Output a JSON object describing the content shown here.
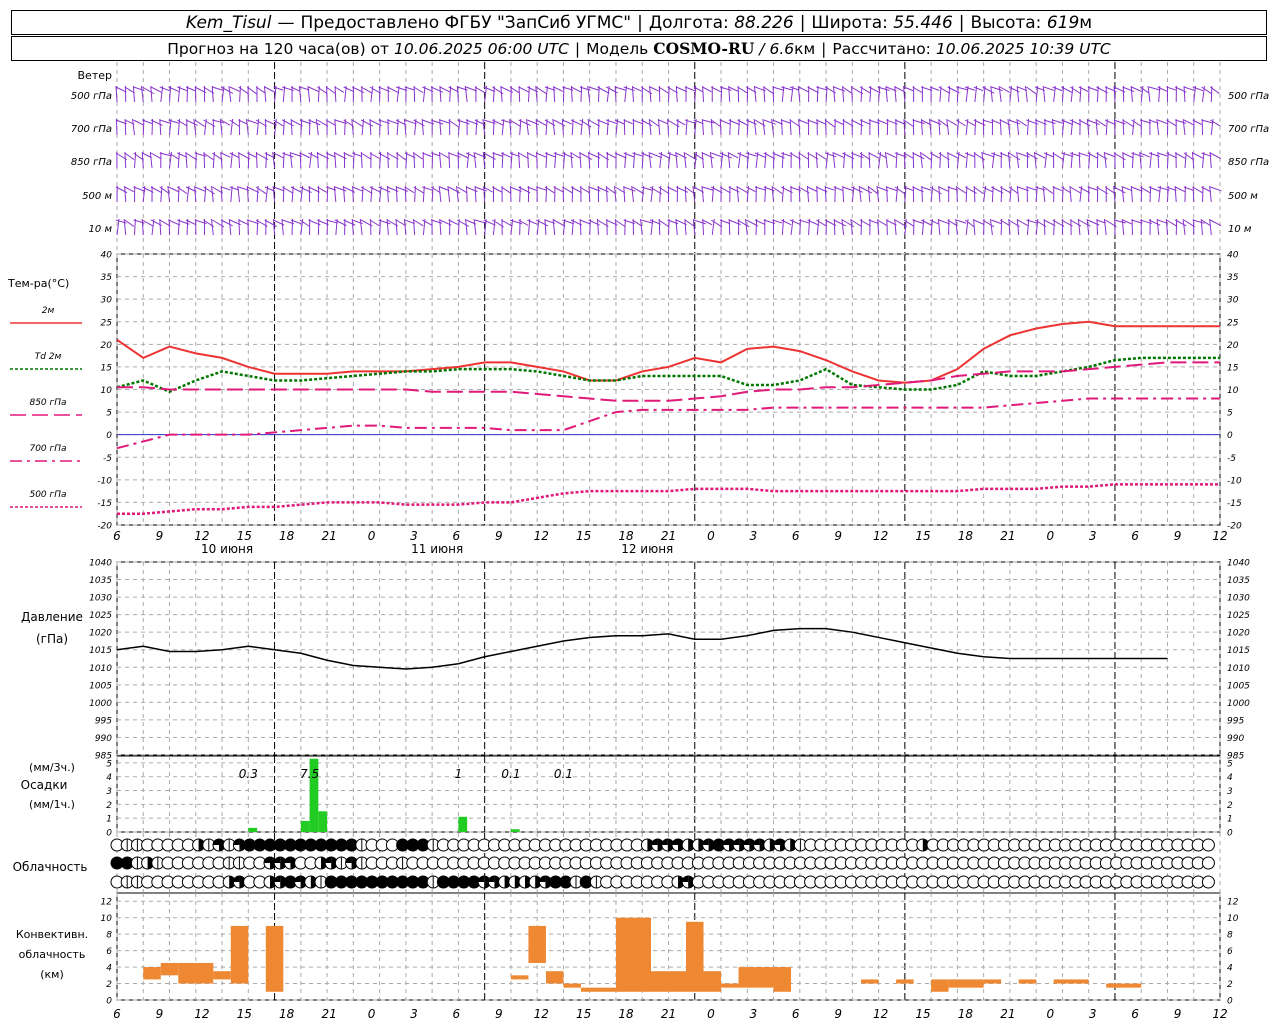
{
  "header": {
    "station": "Kem_Tisul",
    "provider": "Предоставлено ФГБУ \"ЗапСиб УГМС\"",
    "lon_label": "Долгота:",
    "lon_value": "88.226",
    "lat_label": "Широта:",
    "lat_value": "55.446",
    "alt_label": "Высота:",
    "alt_value": "619",
    "alt_unit": "м",
    "forecast_label": "Прогноз на 120 часа(ов)",
    "from_label": "от",
    "init_time": "10.06.2025 06:00 UTC",
    "model_label": "Модель",
    "model_name": "COSMO-RU",
    "model_res": "6.6",
    "model_res_unit": "км",
    "calc_label": "Рассчитано:",
    "calc_time": "10.06.2025 10:39 UTC"
  },
  "colors": {
    "t2m": "#ee3333",
    "td2m": "#007700",
    "t850": "#e0197a",
    "t700": "#e0197a",
    "t500": "#e0197a",
    "wind": "#8833cc",
    "precip": "#22cc22",
    "conv": "#ee8833",
    "pressure": "#000000",
    "zero_line": "#3333cc"
  },
  "wind_panel": {
    "title": "Ветер",
    "levels": [
      "500 гПа",
      "700 гПа",
      "850 гПа",
      "500 м",
      "10  м"
    ]
  },
  "time_axis": {
    "hour_labels": [
      "6",
      "9",
      "12",
      "15",
      "18",
      "21",
      "0",
      "3",
      "6",
      "9",
      "12",
      "15",
      "18",
      "21",
      "0",
      "3",
      "6",
      "9",
      "12",
      "15",
      "18",
      "21",
      "0",
      "3",
      "6",
      "9",
      "12"
    ],
    "dates": [
      "10 июня",
      "11 июня",
      "12 июня"
    ]
  },
  "chart_data": [
    {
      "type": "line",
      "title": "Тем-ра(°C)",
      "x_unit": "hours since 10.06.2025 06:00 UTC",
      "ylim": [
        -20,
        40
      ],
      "yticks": [
        -20,
        -15,
        -10,
        -5,
        0,
        5,
        10,
        15,
        20,
        25,
        30,
        35,
        40
      ],
      "x": [
        0,
        3,
        6,
        9,
        12,
        15,
        18,
        21,
        24,
        27,
        30,
        33,
        36,
        39,
        42,
        45,
        48,
        51,
        54,
        57,
        60,
        63,
        66,
        69,
        72,
        75,
        78,
        81,
        84,
        87,
        90,
        93,
        96,
        99,
        102,
        105,
        108,
        111,
        114,
        117,
        120,
        123,
        126
      ],
      "series": [
        {
          "name": "2м",
          "style": "solid",
          "values": [
            21,
            17,
            19.5,
            18,
            17,
            15,
            13.5,
            13.5,
            13.5,
            14,
            14,
            14,
            14.5,
            15,
            16,
            16,
            15,
            14,
            12,
            12,
            14,
            15,
            17,
            16,
            19,
            19.5,
            18.5,
            16.5,
            14,
            12,
            11.5,
            12,
            14.5,
            19,
            22,
            23.5,
            24.5,
            25,
            24,
            24,
            24,
            24,
            24
          ]
        },
        {
          "name": "Td 2м",
          "style": "dotted",
          "values": [
            10.5,
            12,
            9.5,
            12,
            14,
            13,
            12,
            12,
            12.5,
            13,
            13.5,
            14,
            14,
            14.5,
            14.5,
            14.5,
            14,
            13,
            12,
            12,
            13,
            13,
            13,
            13,
            11,
            11,
            12,
            14.5,
            11,
            10.5,
            10,
            10,
            11,
            14,
            13,
            13,
            14,
            15,
            16.5,
            17,
            17,
            17,
            17
          ]
        },
        {
          "name": "850 гПа",
          "style": "dashed",
          "values": [
            10.5,
            10.5,
            10,
            10,
            10,
            10,
            10,
            10,
            10,
            10,
            10,
            10,
            9.5,
            9.5,
            9.5,
            9.5,
            9,
            8.5,
            8,
            7.5,
            7.5,
            7.5,
            8,
            8.5,
            9.5,
            10,
            10,
            10.5,
            10.5,
            11,
            11.5,
            12,
            13,
            13.5,
            14,
            14,
            14,
            14.5,
            15,
            15.5,
            16,
            16,
            16
          ]
        },
        {
          "name": "700 гПа",
          "style": "dashdot",
          "values": [
            -3,
            -1.5,
            0,
            0,
            0,
            0,
            0.5,
            1,
            1.5,
            2,
            2,
            1.5,
            1.5,
            1.5,
            1.5,
            1,
            1,
            1,
            3,
            5,
            5.5,
            5.5,
            5.5,
            5.5,
            5.5,
            6,
            6,
            6,
            6,
            6,
            6,
            6,
            6,
            6,
            6.5,
            7,
            7.5,
            8,
            8,
            8,
            8,
            8,
            8
          ]
        },
        {
          "name": "500 гПа",
          "style": "dense-dotted",
          "values": [
            -17.5,
            -17.5,
            -17,
            -16.5,
            -16.5,
            -16,
            -16,
            -15.5,
            -15,
            -15,
            -15,
            -15.5,
            -15.5,
            -15.5,
            -15,
            -15,
            -14,
            -13,
            -12.5,
            -12.5,
            -12.5,
            -12.5,
            -12,
            -12,
            -12,
            -12.5,
            -12.5,
            -12.5,
            -12.5,
            -12.5,
            -12.5,
            -12.5,
            -12.5,
            -12,
            -12,
            -12,
            -11.5,
            -11.5,
            -11,
            -11,
            -11,
            -11,
            -11
          ]
        }
      ]
    },
    {
      "type": "line",
      "title": "Давление",
      "ylabel": "(гПа)",
      "x_unit": "hours since 10.06.2025 06:00 UTC",
      "ylim": [
        985,
        1040
      ],
      "yticks": [
        985,
        990,
        995,
        1000,
        1005,
        1010,
        1015,
        1020,
        1025,
        1030,
        1035,
        1040
      ],
      "x": [
        0,
        3,
        6,
        9,
        12,
        15,
        18,
        21,
        24,
        27,
        30,
        33,
        36,
        39,
        42,
        45,
        48,
        51,
        54,
        57,
        60,
        63,
        66,
        69,
        72,
        75,
        78,
        81,
        84,
        87,
        90,
        93,
        96,
        99,
        102,
        105,
        108,
        111,
        114,
        117,
        120
      ],
      "series": [
        {
          "name": "Давление",
          "values": [
            1015,
            1016,
            1014.5,
            1014.5,
            1015,
            1016,
            1015,
            1014,
            1012,
            1010.5,
            1010,
            1009.5,
            1010,
            1011,
            1013,
            1014.5,
            1016,
            1017.5,
            1018.5,
            1019,
            1019,
            1019.5,
            1018,
            1018,
            1019,
            1020.5,
            1021,
            1021,
            1020,
            1018.5,
            1017,
            1015.5,
            1014,
            1013,
            1012.5,
            1012.5,
            1012.5,
            1012.5,
            1012.5,
            1012.5,
            1012.5
          ]
        }
      ]
    },
    {
      "type": "bar",
      "title": "Осадки",
      "ylabel_top": "(мм/3ч.)",
      "ylabel_bottom": "(мм/1ч.)",
      "ylim": [
        0,
        5.5
      ],
      "yticks": [
        0,
        1,
        2,
        3,
        4,
        5
      ],
      "bars_x": [
        15,
        21,
        22,
        23,
        39,
        45
      ],
      "bars_values": [
        0.3,
        0.8,
        5.3,
        1.5,
        1.1,
        0.2
      ],
      "annotations": [
        {
          "x": 15,
          "label": "0.3"
        },
        {
          "x": 22,
          "label": "7.5"
        },
        {
          "x": 39,
          "label": "1"
        },
        {
          "x": 45,
          "label": "0.1"
        },
        {
          "x": 51,
          "label": "0.1"
        }
      ]
    },
    {
      "type": "bar",
      "title": "Конвективн. облачность",
      "ylabel": "(км)",
      "ylim": [
        0,
        13
      ],
      "yticks": [
        0,
        2,
        4,
        6,
        8,
        10,
        12
      ],
      "segments": [
        {
          "x0": 1,
          "x1": 2,
          "base": 2.5,
          "top": 4
        },
        {
          "x0": 2,
          "x1": 3,
          "base": 3,
          "top": 4.5
        },
        {
          "x0": 3,
          "x1": 5,
          "base": 2,
          "top": 4.5
        },
        {
          "x0": 5,
          "x1": 6,
          "base": 2.5,
          "top": 3.5
        },
        {
          "x0": 6,
          "x1": 7,
          "base": 2,
          "top": 9
        },
        {
          "x0": 8,
          "x1": 9,
          "base": 1,
          "top": 9
        },
        {
          "x0": 22,
          "x1": 23,
          "base": 2.5,
          "top": 3
        },
        {
          "x0": 23,
          "x1": 24,
          "base": 4.5,
          "top": 9
        },
        {
          "x0": 24,
          "x1": 25,
          "base": 2,
          "top": 3.5
        },
        {
          "x0": 25,
          "x1": 26,
          "base": 1.5,
          "top": 2
        },
        {
          "x0": 26,
          "x1": 28,
          "base": 1,
          "top": 1.5
        },
        {
          "x0": 28,
          "x1": 30,
          "base": 1,
          "top": 10
        },
        {
          "x0": 30,
          "x1": 32,
          "base": 1,
          "top": 3.5
        },
        {
          "x0": 32,
          "x1": 33,
          "base": 1,
          "top": 9.5
        },
        {
          "x0": 33,
          "x1": 34,
          "base": 1,
          "top": 3.5
        },
        {
          "x0": 34,
          "x1": 35,
          "base": 1.5,
          "top": 2
        },
        {
          "x0": 35,
          "x1": 37,
          "base": 1.5,
          "top": 4
        },
        {
          "x0": 37,
          "x1": 38,
          "base": 1,
          "top": 4
        },
        {
          "x0": 42,
          "x1": 43,
          "base": 2,
          "top": 2.5
        },
        {
          "x0": 44,
          "x1": 45,
          "base": 2,
          "top": 2.5
        },
        {
          "x0": 46,
          "x1": 47,
          "base": 1,
          "top": 2.5
        },
        {
          "x0": 47,
          "x1": 49,
          "base": 1.5,
          "top": 2.5
        },
        {
          "x0": 49,
          "x1": 50,
          "base": 2,
          "top": 2.5
        },
        {
          "x0": 51,
          "x1": 52,
          "base": 2,
          "top": 2.5
        },
        {
          "x0": 53,
          "x1": 55,
          "base": 2,
          "top": 2.5
        },
        {
          "x0": 56,
          "x1": 58,
          "base": 1.5,
          "top": 2
        }
      ]
    }
  ],
  "clouds": {
    "title": "Облачность",
    "rows": [
      [
        0,
        1,
        1,
        0,
        0,
        0,
        0,
        0,
        2,
        1,
        3,
        1,
        3,
        4,
        4,
        4,
        4,
        4,
        4,
        4,
        4,
        4,
        4,
        4,
        1,
        0,
        0,
        0,
        4,
        4,
        4,
        1,
        0,
        0,
        0,
        0,
        0,
        0,
        0,
        0,
        0,
        0,
        0,
        0,
        0,
        0,
        0,
        0,
        0,
        0,
        0,
        0,
        2,
        3,
        3,
        3,
        2,
        2,
        3,
        4,
        3,
        3,
        3,
        3,
        2,
        3,
        2,
        1,
        0,
        0,
        0,
        0,
        0,
        0,
        0,
        0,
        0,
        0,
        0,
        2,
        0,
        0,
        0,
        0,
        0,
        0,
        0,
        0,
        0,
        0,
        0,
        0,
        0,
        0,
        0,
        0,
        0,
        0,
        0,
        0,
        0,
        0,
        0,
        0,
        0,
        0,
        0,
        0
      ],
      [
        4,
        4,
        1,
        2,
        1,
        0,
        0,
        0,
        0,
        0,
        0,
        1,
        1,
        0,
        0,
        3,
        3,
        3,
        0,
        0,
        2,
        3,
        1,
        3,
        1,
        0,
        0,
        0,
        1,
        0,
        0,
        0,
        0,
        0,
        0,
        0,
        0,
        0,
        0,
        0,
        0,
        0,
        0,
        0,
        0,
        0,
        0,
        0,
        0,
        0,
        0,
        0,
        0,
        0,
        0,
        0,
        0,
        0,
        0,
        0,
        0,
        0,
        0,
        0,
        0,
        0,
        0,
        0,
        0,
        0,
        0,
        0,
        0,
        0,
        0,
        0,
        0,
        0,
        0,
        0,
        0,
        0,
        0,
        0,
        0,
        0,
        0,
        0,
        0,
        0,
        0,
        0,
        0,
        0,
        0,
        0,
        0,
        0,
        0,
        0,
        0,
        0,
        0,
        0,
        0,
        0,
        0,
        0
      ],
      [
        0,
        1,
        1,
        0,
        0,
        0,
        0,
        0,
        0,
        0,
        0,
        2,
        3,
        0,
        0,
        2,
        3,
        4,
        3,
        2,
        1,
        4,
        4,
        4,
        4,
        4,
        4,
        4,
        4,
        4,
        4,
        1,
        4,
        4,
        4,
        4,
        3,
        3,
        2,
        2,
        2,
        2,
        3,
        4,
        4,
        1,
        4,
        1,
        0,
        0,
        0,
        0,
        0,
        0,
        0,
        2,
        3,
        0,
        0,
        0,
        0,
        0,
        0,
        0,
        0,
        0,
        0,
        0,
        0,
        0,
        0,
        0,
        0,
        0,
        0,
        0,
        0,
        0,
        0,
        0,
        0,
        0,
        0,
        0,
        0,
        0,
        0,
        0,
        0,
        0,
        0,
        0,
        0,
        0,
        0,
        0,
        0,
        0,
        0,
        0,
        0,
        0,
        0,
        0,
        0,
        0,
        0,
        0
      ]
    ]
  }
}
